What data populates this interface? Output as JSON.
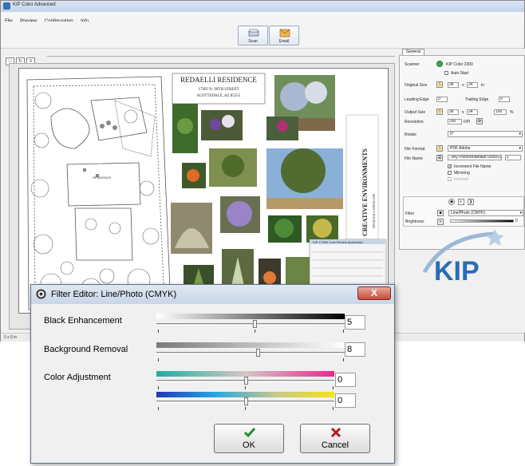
{
  "app": {
    "title": "KIP Color Advanced",
    "menu": [
      "File",
      "Preview",
      "Configuration",
      "Info"
    ],
    "toolbar": {
      "scan_label": "Scan",
      "email_label": "Email"
    },
    "status_text": "0 x 0 in"
  },
  "drawing": {
    "title": "REDAELLI RESIDENCE",
    "address1": "17995 N. 99TH STREET",
    "address2": "SCOTTSDALE, AZ 85255",
    "side_title": "CREATIVE ENVIRONMENTS",
    "side_sub": "DESIGN & LANDSCAPE",
    "plan_label": "RESIDENCE",
    "kip_panel": "KIP C7800 Cost Review Application"
  },
  "panel": {
    "tab": "General",
    "scanner_label": "Scanner",
    "scanner_value": "KIP Color 2300",
    "auto_start": "Auto Start",
    "original_size_label": "Original Size",
    "orig_w": "36",
    "orig_h": "24",
    "unit": "in",
    "leading_edge_label": "Leading Edge",
    "leading_val": "0",
    "trailing_edge_label": "Trailing Edge",
    "trailing_val": "0",
    "output_size_label": "Output Size",
    "out_w": "36",
    "out_h": "24",
    "out_pct": "100",
    "pct": "%",
    "resolution_label": "Resolution",
    "resolution_val": "200",
    "dpi": "DPI",
    "rotate_label": "Rotate",
    "rotate_val": "0°",
    "file_format_label": "File Format",
    "file_format_val": "PDF Adobe",
    "file_name_label": "File Name",
    "file_name_val": "..\\My Pictures\\default 00000.pdf",
    "file_count": "1",
    "increment": "Increment File Name",
    "mirroring": "Mirroring",
    "inverted": "Inverted",
    "filter_label": "Filter",
    "filter_val": "Line/Photo (CMYK)",
    "brightness_label": "Brightness",
    "brightness_val": "0"
  },
  "logo": {
    "text": "KIP"
  },
  "dialog": {
    "title": "Filter Editor: Line/Photo (CMYK)",
    "close_label": "X",
    "black_label": "Black Enhancement",
    "black_value": "5",
    "bg_label": "Background Removal",
    "bg_value": "8",
    "color_label": "Color Adjustment",
    "color1_value": "0",
    "color2_value": "0",
    "ok_label": "OK",
    "cancel_label": "Cancel"
  },
  "colors": {
    "accent": "#2a6db5",
    "ok_green": "#1f8f2c",
    "cancel_red": "#b3191e",
    "close_red": "#c74b37"
  }
}
